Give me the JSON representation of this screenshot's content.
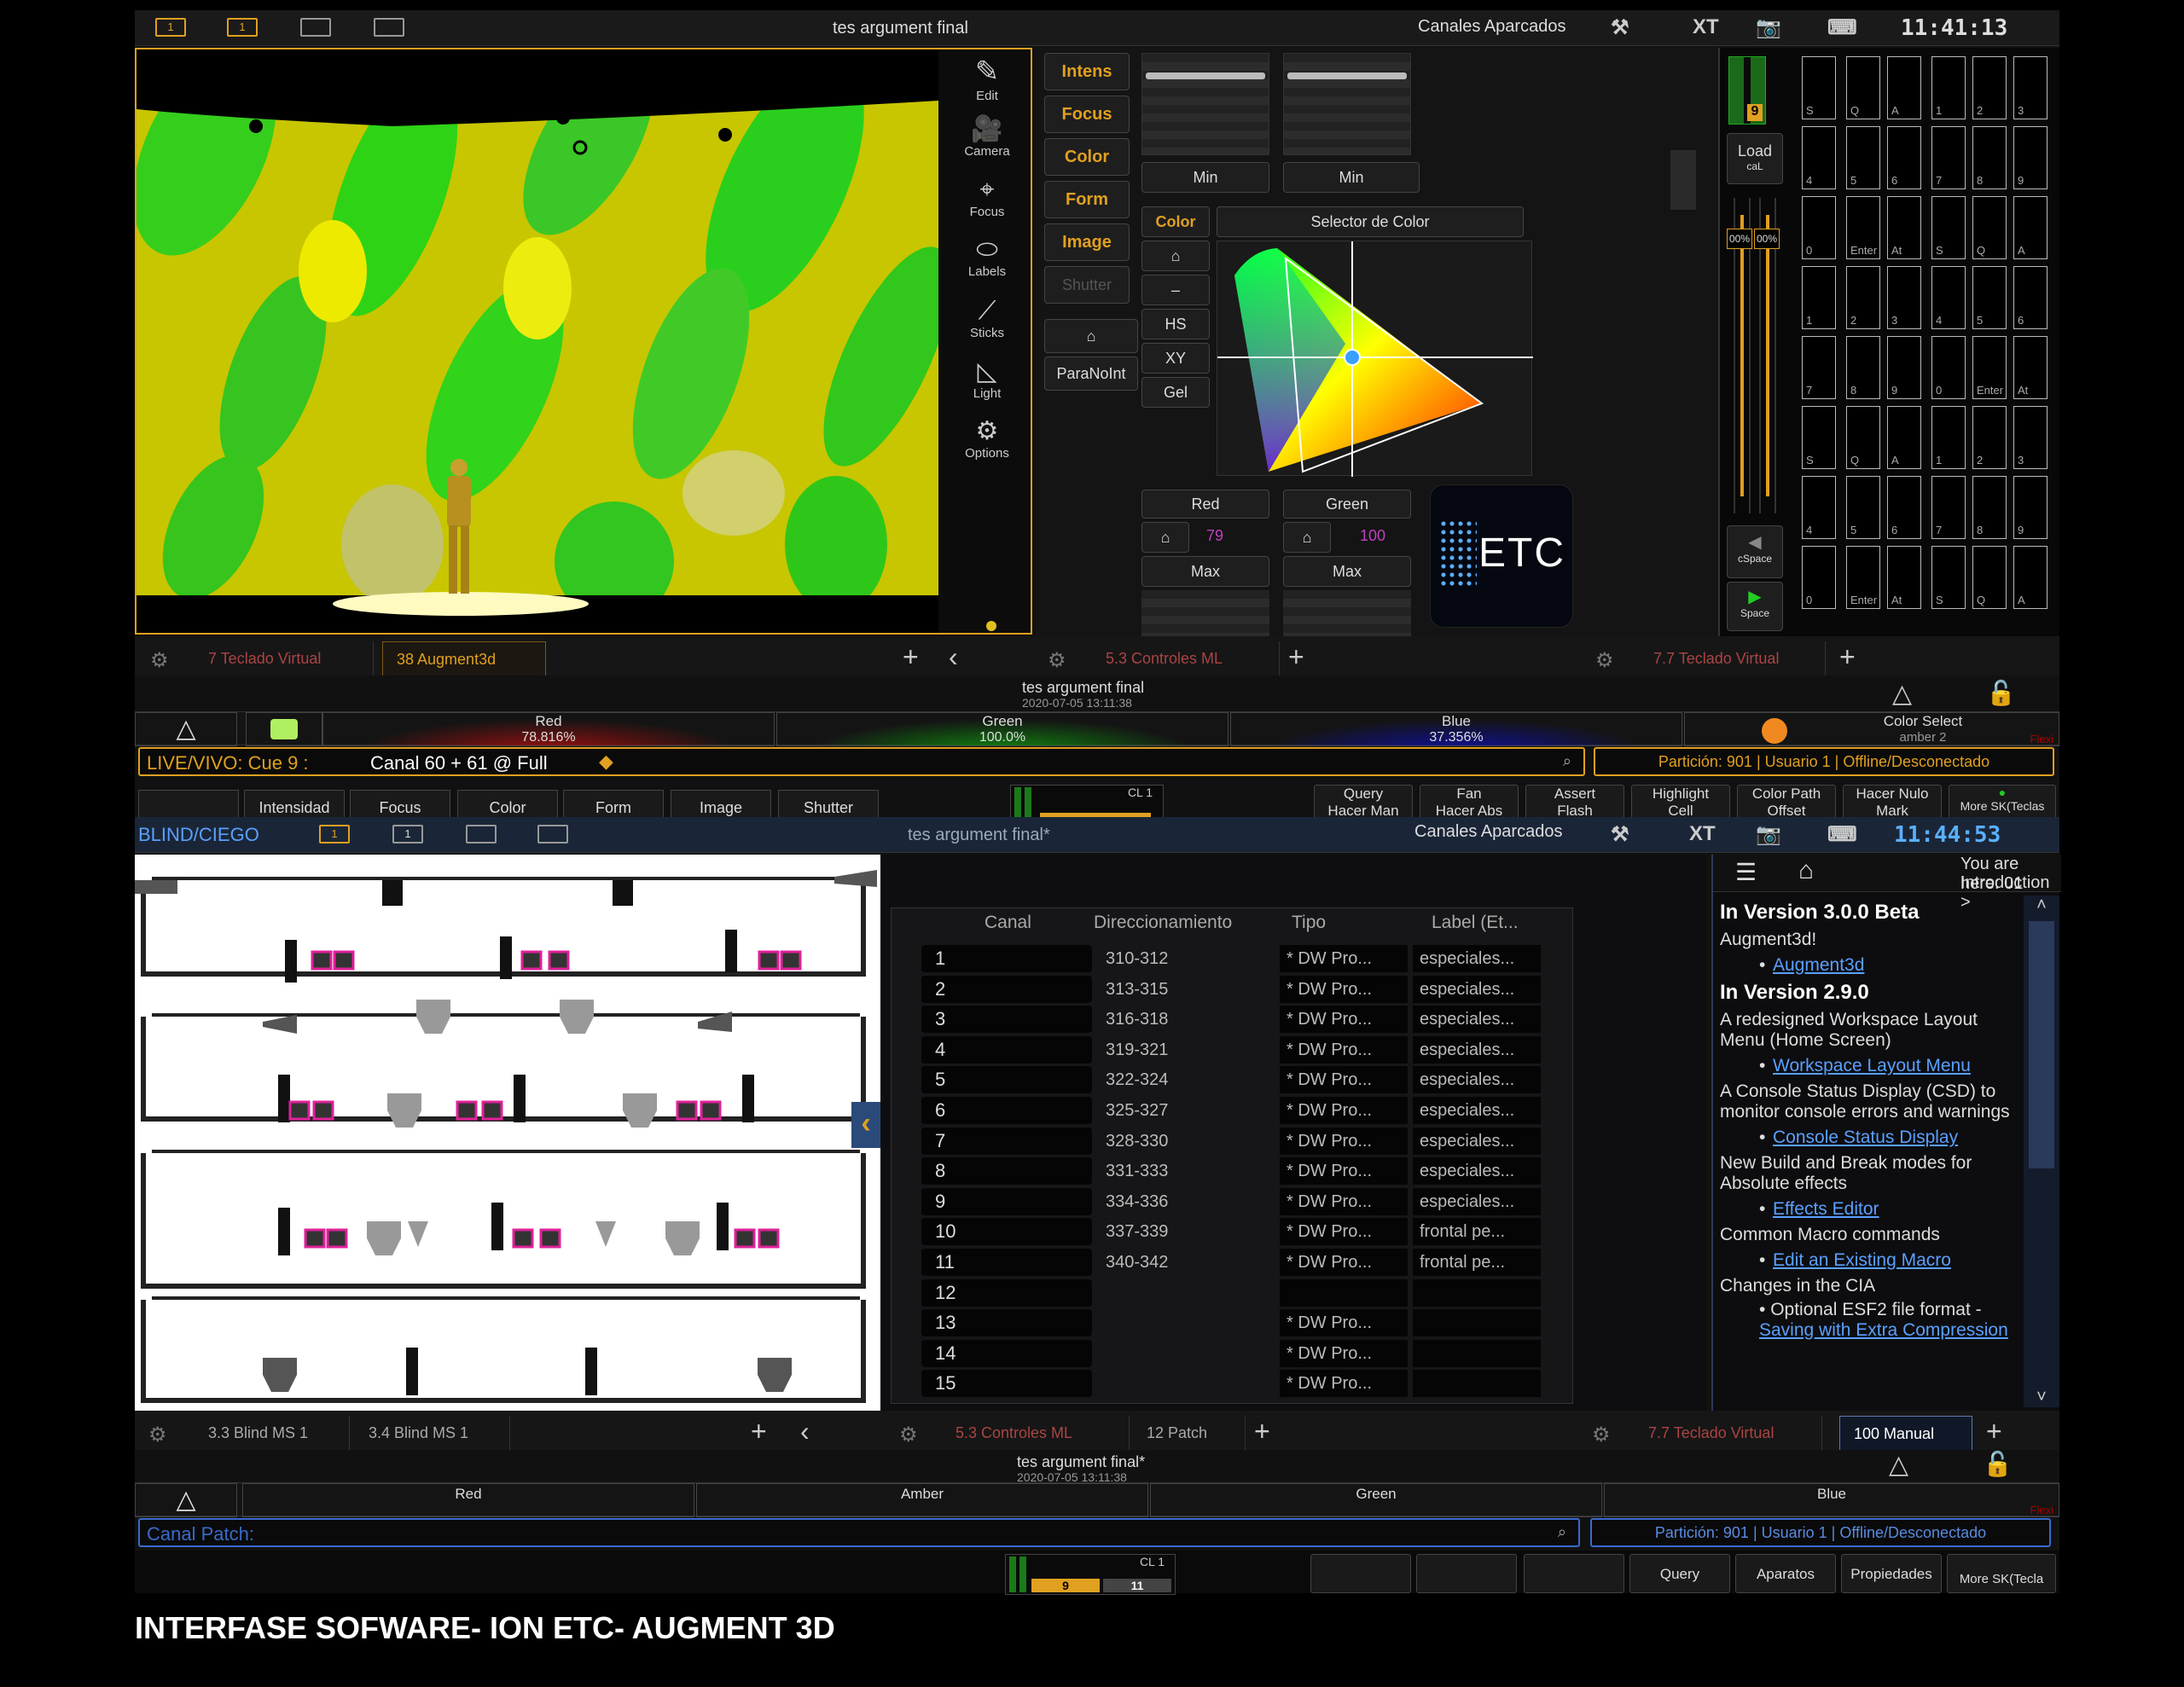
{
  "top": {
    "ws_buttons": [
      "1",
      "1",
      "",
      ""
    ],
    "title": "tes argument final",
    "parked": "Canales Aparcados",
    "brand": "XT",
    "clock": "11:41:13",
    "toolbar": [
      "Edit",
      "Camera",
      "Focus",
      "Labels",
      "Sticks",
      "Light",
      "Options"
    ],
    "param_buttons": [
      "Intens",
      "Focus",
      "Color",
      "Form",
      "Image",
      "Shutter"
    ],
    "home_label": "⌂",
    "paranoint": "ParaNoInt",
    "min": "Min",
    "color_mode": [
      "Color",
      "⌂",
      "–",
      "HS",
      "XY",
      "Gel"
    ],
    "selector_title": "Selector de Color",
    "red_label": "Red",
    "green_label": "Green",
    "red_value": "79",
    "green_value": "100",
    "max": "Max",
    "etc_logo": "ETC",
    "load": "Load",
    "cal": "caL",
    "cspace": "cSpace",
    "space": "Space",
    "fader_value": "9",
    "fader_pct": [
      "00%",
      "00%"
    ],
    "tabs_left": [
      "7 Teclado Virtual",
      "38 Augment3d"
    ],
    "tabs_mid": [
      "5.3 Controles ML"
    ],
    "tabs_right": [
      "7.7 Teclado Virtual"
    ],
    "footer_title": "tes argument final",
    "footer_date": "2020-07-05 13:11:38",
    "mix": [
      {
        "name": "Red",
        "value": "78.816%"
      },
      {
        "name": "Green",
        "value": "100.0%"
      },
      {
        "name": "Blue",
        "value": "37.356%"
      },
      {
        "name": "Color Select",
        "value": "amber 2"
      }
    ],
    "flexi": "Flexi",
    "cmd_mode": "LIVE/VIVO: Cue  9 :",
    "cmd_text": "Canal 60 + 61 @ Full",
    "status_text": "Partición: 901 | Usuario 1 | Offline/Desconectado",
    "param_tabs": [
      "Intensidad",
      "Focus",
      "Color",
      "Form",
      "Image",
      "Shutter"
    ],
    "cl": "CL 1",
    "softkeys": [
      {
        "top": "Query",
        "bottom": "Hacer Man"
      },
      {
        "top": "Fan",
        "bottom": "Hacer Abs"
      },
      {
        "top": "Assert",
        "bottom": "Flash"
      },
      {
        "top": "Highlight",
        "bottom": "Cell"
      },
      {
        "top": "Color Path",
        "bottom": "Offset"
      },
      {
        "top": "Hacer Nulo",
        "bottom": "Mark"
      },
      {
        "top": "",
        "bottom": "More SK(Teclas"
      }
    ],
    "keypad_labels": [
      "S",
      "Q",
      "A",
      "1",
      "2",
      "3",
      "4",
      "5",
      "6",
      "7",
      "8",
      "9",
      "0",
      "Enter",
      "At"
    ]
  },
  "bottom": {
    "mode": "BLIND/CIEGO",
    "ws_buttons": [
      "1",
      "1",
      "",
      ""
    ],
    "title": "tes argument final*",
    "parked": "Canales Aparcados",
    "brand": "XT",
    "clock": "11:44:53",
    "patch_headers": [
      "Canal",
      "Direccionamiento",
      "Tipo",
      "Label (Et..."
    ],
    "patch_rows": [
      {
        "ch": "1",
        "addr": "310-312",
        "type": "* DW Pro...",
        "label": "especiales..."
      },
      {
        "ch": "2",
        "addr": "313-315",
        "type": "* DW Pro...",
        "label": "especiales..."
      },
      {
        "ch": "3",
        "addr": "316-318",
        "type": "* DW Pro...",
        "label": "especiales..."
      },
      {
        "ch": "4",
        "addr": "319-321",
        "type": "* DW Pro...",
        "label": "especiales..."
      },
      {
        "ch": "5",
        "addr": "322-324",
        "type": "* DW Pro...",
        "label": "especiales..."
      },
      {
        "ch": "6",
        "addr": "325-327",
        "type": "* DW Pro...",
        "label": "especiales..."
      },
      {
        "ch": "7",
        "addr": "328-330",
        "type": "* DW Pro...",
        "label": "especiales..."
      },
      {
        "ch": "8",
        "addr": "331-333",
        "type": "* DW Pro...",
        "label": "especiales..."
      },
      {
        "ch": "9",
        "addr": "334-336",
        "type": "* DW Pro...",
        "label": "especiales..."
      },
      {
        "ch": "10",
        "addr": "337-339",
        "type": "* DW Pro...",
        "label": "frontal pe..."
      },
      {
        "ch": "11",
        "addr": "340-342",
        "type": "* DW Pro...",
        "label": "frontal pe..."
      },
      {
        "ch": "12",
        "addr": "",
        "type": "",
        "label": ""
      },
      {
        "ch": "13",
        "addr": "",
        "type": "* DW Pro...",
        "label": ""
      },
      {
        "ch": "14",
        "addr": "",
        "type": "* DW Pro...",
        "label": ""
      },
      {
        "ch": "15",
        "addr": "",
        "type": "* DW Pro...",
        "label": ""
      }
    ],
    "help": {
      "breadcrumb1": "You are here: 01",
      "breadcrumb2": "Introduction >",
      "h1": "In Version 3.0.0 Beta",
      "p1": "Augment3d!",
      "a1": "Augment3d",
      "h2": "In Version 2.9.0",
      "p2": "A redesigned Workspace Layout Menu (Home Screen)",
      "a2": "Workspace Layout Menu",
      "p3": "A Console Status Display (CSD) to monitor console errors and warnings",
      "a3": "Console Status Display",
      "p4": "New Build and Break modes for Absolute effects",
      "a4": "Effects Editor",
      "p5": "Common Macro commands",
      "a5": "Edit an Existing Macro",
      "p6": "Changes in the CIA",
      "p7a": "Optional ESF2 file format - ",
      "p7b": "Saving with Extra Compression"
    },
    "tabs_left": [
      "3.3 Blind MS 1",
      "3.4 Blind MS 1"
    ],
    "tabs_mid": [
      "5.3 Controles ML",
      "12 Patch"
    ],
    "tabs_right": [
      "7.7 Teclado Virtual",
      "100 Manual"
    ],
    "footer_title": "tes argument final*",
    "footer_date": "2020-07-05 13:11:38",
    "mix": [
      "Red",
      "Amber",
      "Green",
      "Blue"
    ],
    "flexi": "Flexi",
    "cmd_text": "Canal Patch:",
    "status_text": "Partición: 901 | Usuario 1 | Offline/Desconectado",
    "cl": "CL 1",
    "fader_vals": [
      "9",
      "11"
    ],
    "softkeys": [
      "",
      "",
      "",
      "Query",
      "Aparatos",
      "Propiedades",
      "More SK(Tecla"
    ]
  },
  "caption": "INTERFASE SOFWARE- ION ETC- AUGMENT 3D"
}
